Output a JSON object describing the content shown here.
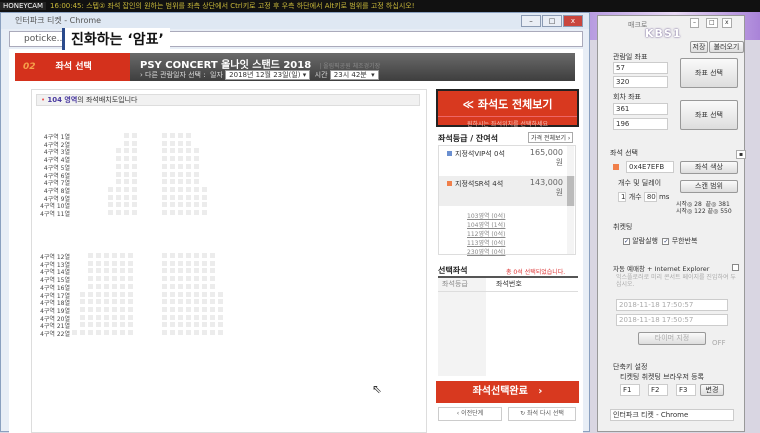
{
  "overlay": {
    "watermark": "HONEYCAM",
    "notice": "16:00:45: 스텝② 좌석 잡인의 원하는 범위를 좌측 상단에서 Ctrl키로 고정 후 우측 하단에서 Alt키로 범위를 고정 하십시오!",
    "caption": "진화하는 ‘암표’",
    "tv_logo": "KBS1"
  },
  "browser": {
    "title": "인터파크 티켓 - Chrome",
    "url": "poticke...ookMain.asp"
  },
  "header": {
    "step_no": "02",
    "step_label": "좌석 선택",
    "concert_title": "PSY CONCERT 올나잇 스탠드 2018",
    "venue": "| 올림픽공원 체조경기장",
    "date_label": "› 다른 관람일자 선택 :",
    "date_field": "일자",
    "date_value": "2018년 12월 23일(일)",
    "time_field": "시간",
    "time_value": "23시 42분"
  },
  "seatmap": {
    "zone": "104 영역",
    "zone_suffix": "의 좌석배치도입니다",
    "rows": [
      "4구역 1열",
      "4구역 2열",
      "4구역 3열",
      "4구역 4열",
      "4구역 5열",
      "4구역 6열",
      "4구역 7열",
      "4구역 8열",
      "4구역 9열",
      "4구역 10열",
      "4구역 11열",
      "4구역 12열",
      "4구역 13열",
      "4구역 14열",
      "4구역 15열",
      "4구역 16열",
      "4구역 17열",
      "4구역 18열",
      "4구역 19열",
      "4구역 20열",
      "4구역 21열",
      "4구역 22열"
    ]
  },
  "right": {
    "full_view": "≪ 좌석도 전체보기",
    "full_view_sub": "원하시는 좌석위치를 선택하세요",
    "grade_title": "좌석등급 / 잔여석",
    "price_all": "가격 전체보기 ›",
    "grades": [
      {
        "name": "지정석VIP석 0석",
        "price": "165,000",
        "unit": "원",
        "color": "#6a8fd0"
      },
      {
        "name": "지정석SR석 4석",
        "price": "143,000",
        "unit": "원",
        "color": "#f07f4a"
      }
    ],
    "zones": [
      "103영역 (0석)",
      "104영역 (1석)",
      "112영역 (0석)",
      "113영역 (0석)",
      "230영역 (0석)"
    ],
    "selected_title": "선택좌석",
    "selected_count": "총 0석 선택되었습니다.",
    "col_grade": "좌석등급",
    "col_number": "좌석번호",
    "complete": "좌석선택완료",
    "prev": "‹ 이전단계",
    "reselect": "↻ 좌석 다시 선택"
  },
  "macro": {
    "title": "매크로",
    "save": "저장",
    "load": "불러오기",
    "date_coord": "관람일 좌표",
    "dx": "57",
    "dy": "320",
    "coord_btn": "좌표 선택",
    "round_coord": "회차 좌표",
    "rx": "361",
    "ry": "196",
    "seat_select": "좌석 선택",
    "color_value": "0x4E7EFB",
    "color_btn": "좌석 색상",
    "count_delay": "개수 및 딜레이",
    "count": "1",
    "count_lbl": "개수",
    "delay": "80",
    "ms": "ms",
    "scan_btn": "스캔 범위",
    "start1": "시작◎ 28",
    "end1": "끝◎ 381",
    "start2": "시작◎ 122",
    "end2": "끝◎ 550",
    "ticketing": "취켓팅",
    "alarm": "알람실행",
    "loop": "무한반복",
    "auto": "자동 예매창 + Internet Explorer",
    "auto_hint": "익스플로러로 미리 콘서트 페이지를 진입하여 두십시오.",
    "dt1": "2018-11-18 17:50:57",
    "dt2": "2018-11-18 17:50:57",
    "timer_btn": "타이머 지정",
    "off": "OFF",
    "hotkey": "단축키 설정",
    "hk1": "티켓팅",
    "hk2": "취켓팅",
    "hk3": "브라우저 등록",
    "f1": "F1",
    "f2": "F2",
    "f3": "F3",
    "change": "변경",
    "browser_name": "인터파크 티켓 - Chrome"
  }
}
